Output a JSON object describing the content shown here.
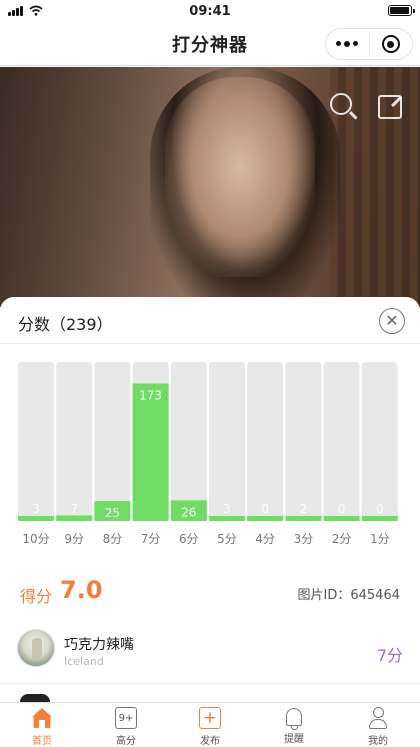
{
  "status_bar": {
    "time": "09:41"
  },
  "nav": {
    "title": "打分神器",
    "more_icon": "more-dots-icon",
    "close_icon": "target-icon"
  },
  "hero": {
    "search_icon": "search-icon",
    "share_icon": "share-icon"
  },
  "sheet": {
    "title": "分数（239）",
    "close_icon": "close-icon",
    "close_glyph": "✕"
  },
  "chart_data": {
    "type": "bar",
    "categories": [
      "10分",
      "9分",
      "8分",
      "7分",
      "6分",
      "5分",
      "4分",
      "3分",
      "2分",
      "1分"
    ],
    "values": [
      3,
      7,
      25,
      173,
      26,
      3,
      0,
      2,
      0,
      0
    ],
    "ylim": [
      0,
      200
    ],
    "bar_color": "#6fdc64",
    "track_color": "#e8e8e8",
    "label_color": "#ffffff"
  },
  "score": {
    "label": "得分",
    "value": "7.0",
    "photo_id": "图片ID：645464",
    "color": "#f07f3c"
  },
  "comments": [
    {
      "name": "巧克力辣嘴",
      "location": "Iceland",
      "score": "7分",
      "score_color": "#9b6ad6"
    }
  ],
  "tabs": [
    {
      "label": "首页",
      "icon": "home-icon",
      "active": true
    },
    {
      "label": "高分",
      "icon": "score-icon",
      "glyph": "9+"
    },
    {
      "label": "发布",
      "icon": "publish-icon",
      "glyph": "+"
    },
    {
      "label": "提醒",
      "icon": "bell-icon"
    },
    {
      "label": "我的",
      "icon": "user-icon"
    }
  ]
}
